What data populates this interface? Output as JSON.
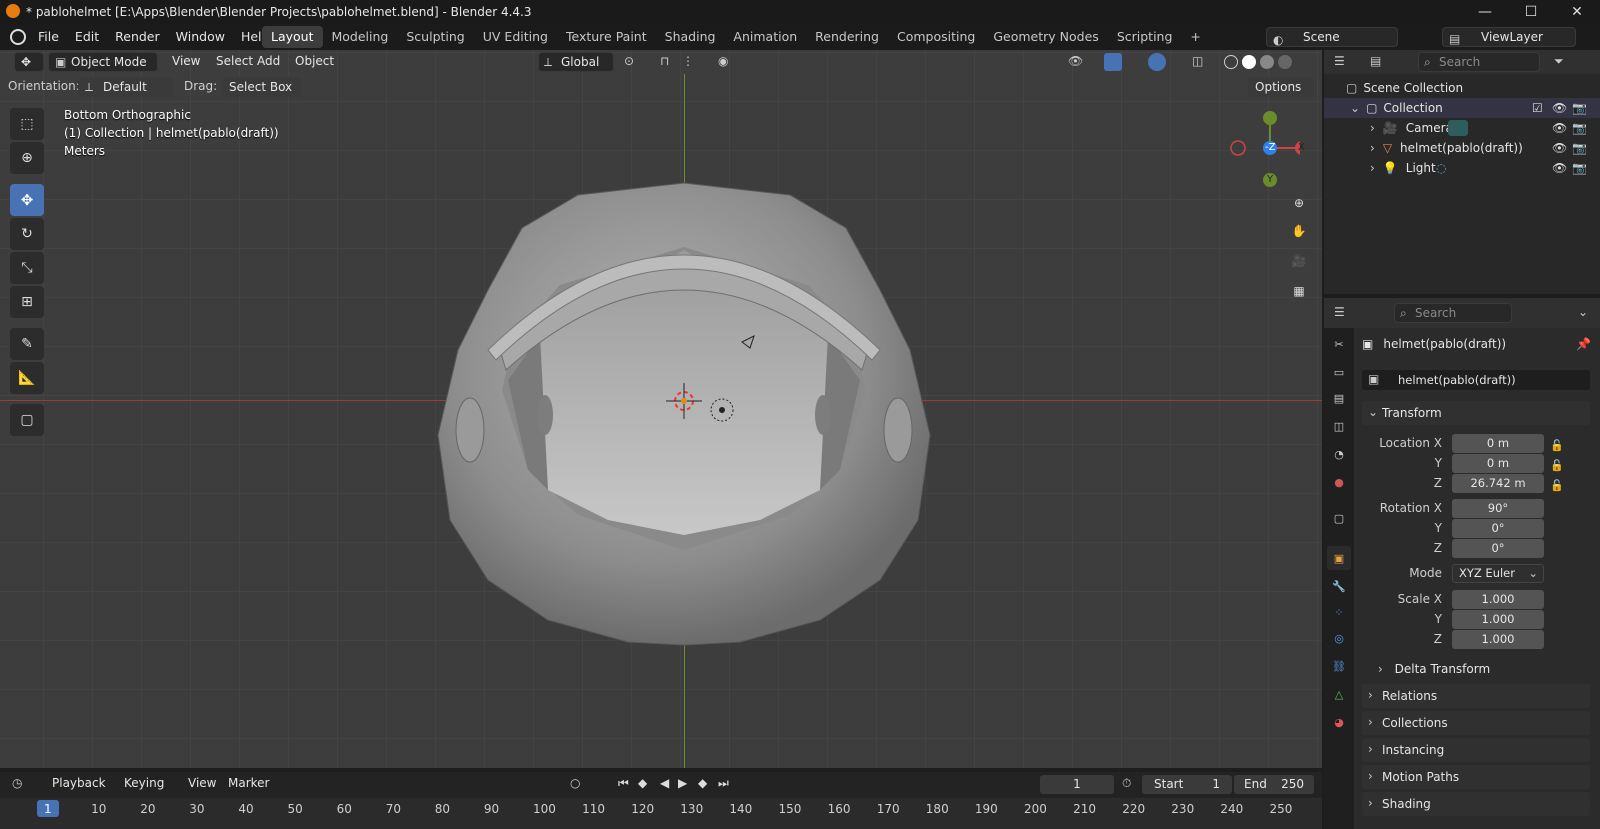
{
  "window": {
    "title": "* pablohelmet [E:\\Apps\\Blender\\Blender Projects\\pablohelmet.blend] - Blender 4.4.3",
    "minimize": "—",
    "maximize": "☐",
    "close": "✕"
  },
  "menu": [
    "File",
    "Edit",
    "Render",
    "Window",
    "Help"
  ],
  "workspaces": [
    "Layout",
    "Modeling",
    "Sculpting",
    "UV Editing",
    "Texture Paint",
    "Shading",
    "Animation",
    "Rendering",
    "Compositing",
    "Geometry Nodes",
    "Scripting"
  ],
  "active_workspace": "Layout",
  "add_workspace": "+",
  "scene": "Scene",
  "view_layer": "ViewLayer",
  "viewport": {
    "mode": "Object Mode",
    "header_menus": [
      "View",
      "Select",
      "Add",
      "Object"
    ],
    "transform_orientation": "Global",
    "orientation_label": "Orientation:",
    "orientation_value": "Default",
    "drag_label": "Drag:",
    "drag_value": "Select Box",
    "options": "Options",
    "overlay_view": "Bottom Orthographic",
    "overlay_collection": "(1) Collection | helmet(pablo(draft))",
    "overlay_units": "Meters",
    "gizmo": {
      "neg_z": "-Z",
      "x": "X",
      "y": "Y"
    }
  },
  "outliner": {
    "search_placeholder": "Search",
    "scene_collection": "Scene Collection",
    "collection": "Collection",
    "items": [
      {
        "name": "Camera",
        "icon": "camera-icon"
      },
      {
        "name": "helmet(pablo(draft))",
        "icon": "mesh-icon"
      },
      {
        "name": "Light",
        "icon": "light-icon"
      }
    ]
  },
  "properties": {
    "search_placeholder": "Search",
    "object_name": "helmet(pablo(draft))",
    "datablock": "helmet(pablo(draft))",
    "transform": "Transform",
    "location": {
      "label": "Location X",
      "x": "0 m",
      "y": "0 m",
      "z": "26.742 m"
    },
    "rotation": {
      "label": "Rotation X",
      "x": "90°",
      "y": "0°",
      "z": "0°"
    },
    "mode_label": "Mode",
    "mode_value": "XYZ Euler",
    "scale": {
      "label": "Scale X",
      "x": "1.000",
      "y": "1.000",
      "z": "1.000"
    },
    "axis_y": "Y",
    "axis_z": "Z",
    "delta_transform": "Delta Transform",
    "sections": [
      "Relations",
      "Collections",
      "Instancing",
      "Motion Paths",
      "Shading"
    ]
  },
  "timeline": {
    "menus": [
      "Playback",
      "Keying",
      "View",
      "Marker"
    ],
    "current_frame": "1",
    "start_label": "Start",
    "start": "1",
    "end_label": "End",
    "end": "250",
    "ticks": [
      "1",
      "10",
      "20",
      "30",
      "40",
      "50",
      "60",
      "70",
      "80",
      "90",
      "100",
      "110",
      "120",
      "130",
      "140",
      "150",
      "160",
      "170",
      "180",
      "190",
      "200",
      "210",
      "220",
      "230",
      "240",
      "250"
    ]
  },
  "colors": {
    "accent": "#4772b3",
    "x_axis": "#a03a3a",
    "y_axis": "#6a8d2a",
    "gizmo_z": "#2f80ed"
  }
}
